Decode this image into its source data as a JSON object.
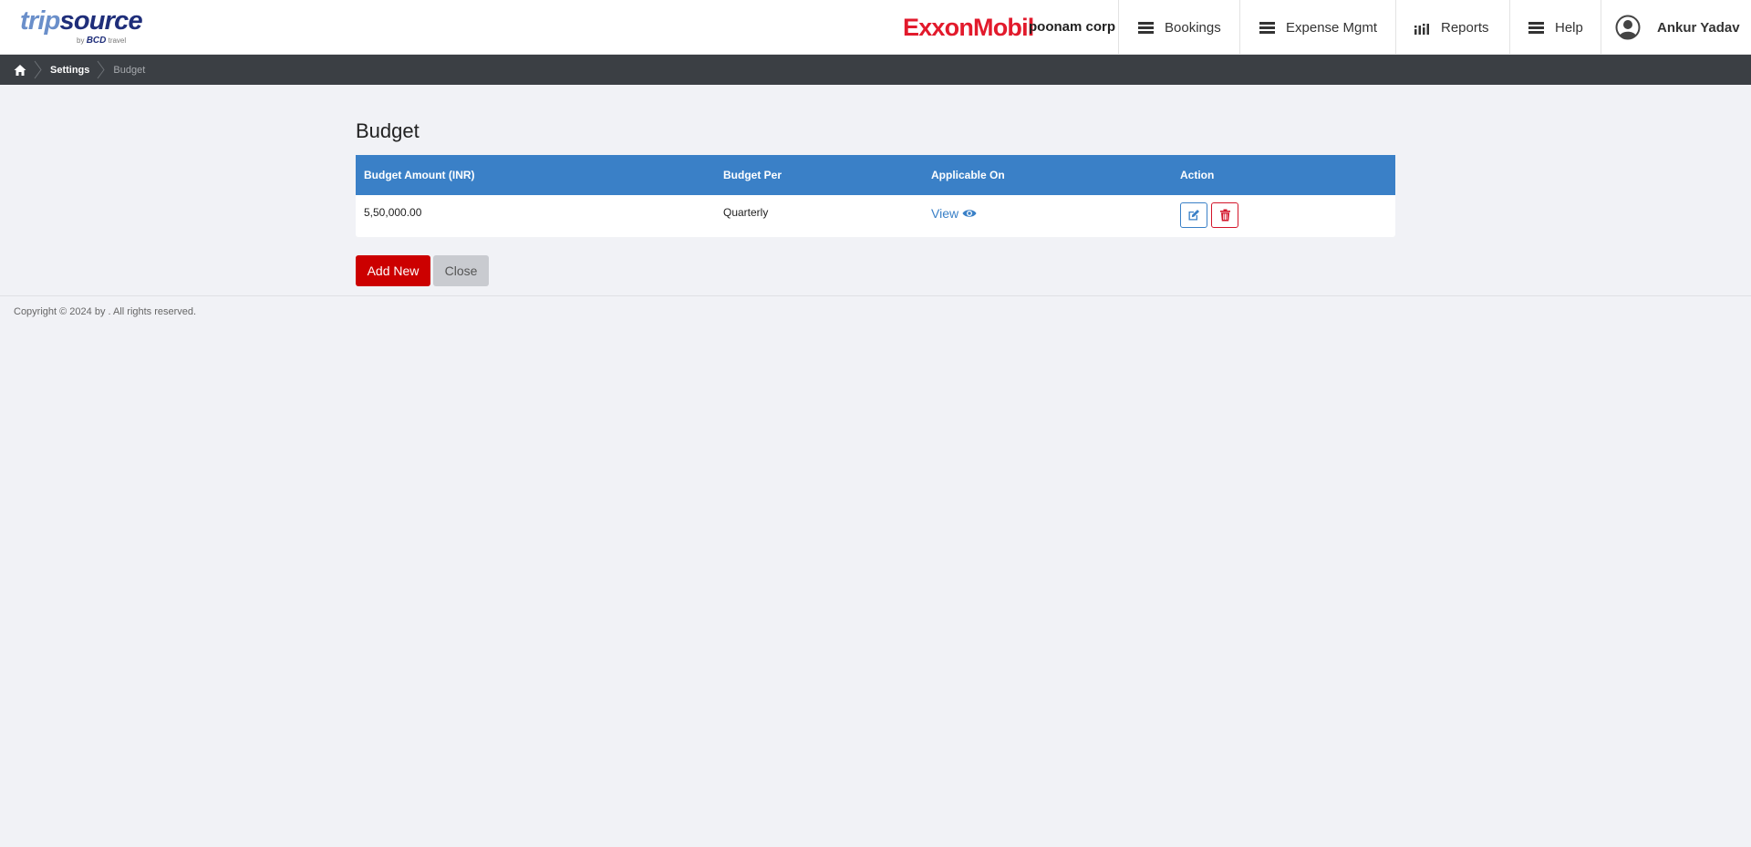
{
  "header": {
    "logo_trip": "trip",
    "logo_source": "source",
    "logo_by": "by",
    "logo_bcd": "BCD",
    "logo_travel": "travel",
    "brand": "ExxonMobil",
    "corp": "poonam corp",
    "nav": {
      "bookings": "Bookings",
      "expense": "Expense Mgmt",
      "reports": "Reports",
      "help": "Help"
    },
    "user": "Ankur Yadav"
  },
  "breadcrumb": {
    "settings": "Settings",
    "current": "Budget"
  },
  "page": {
    "title": "Budget"
  },
  "table": {
    "headers": [
      "Budget Amount (INR)",
      "Budget Per",
      "Applicable On",
      "Action"
    ],
    "rows": [
      {
        "amount": "5,50,000.00",
        "per": "Quarterly",
        "applicable": "View"
      }
    ]
  },
  "buttons": {
    "add_new": "Add New",
    "close": "Close"
  },
  "footer": {
    "copyright": "Copyright © 2024 by . All rights reserved."
  },
  "colors": {
    "accent_blue": "#3a80c7",
    "danger_red": "#cc0000",
    "brand_red": "#e21a2c",
    "breadcrumb_bg": "#3b3f44"
  }
}
